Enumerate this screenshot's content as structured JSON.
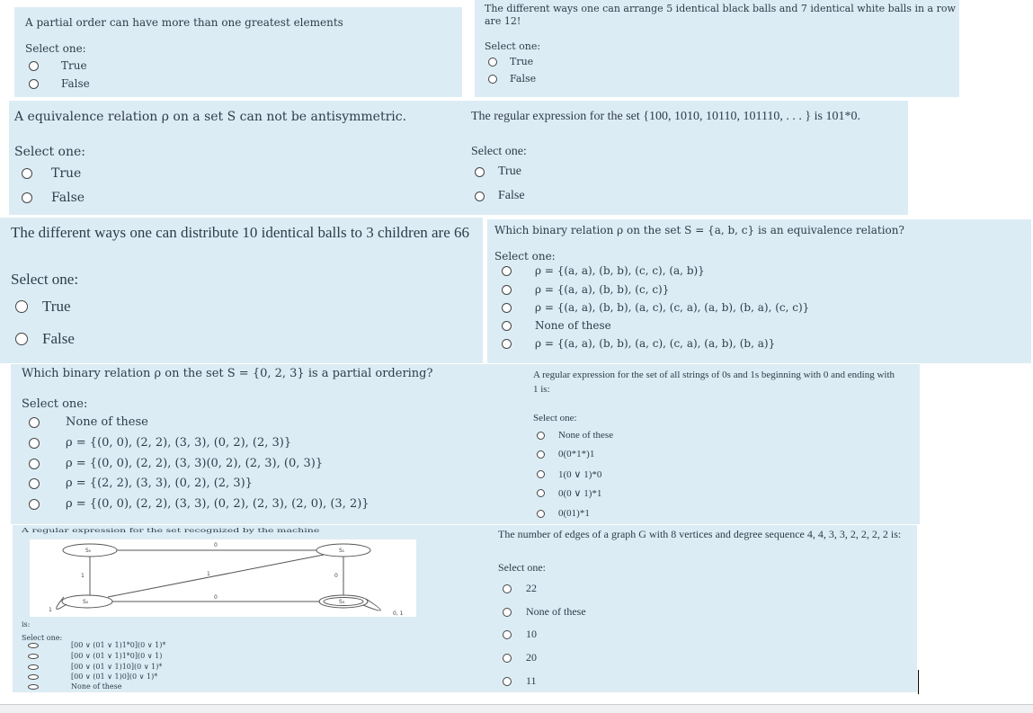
{
  "common": {
    "select_one": "Select one:"
  },
  "q1": {
    "question": "A partial order can have more than one greatest elements",
    "options": [
      "True",
      "False"
    ]
  },
  "q2": {
    "question_line1": "The different ways one can arrange 5 identical black balls and 7 identical white balls in a row",
    "question_line2": "are 12!",
    "options": [
      "True",
      "False"
    ]
  },
  "q3": {
    "question": "A equivalence relation ρ on a set S can not be antisymmetric.",
    "options": [
      "True",
      "False"
    ]
  },
  "q4": {
    "question": "The regular expression for the set {100, 1010, 10110, 101110, . . . } is 101*0.",
    "options": [
      "True",
      "False"
    ]
  },
  "q5": {
    "question": "The different ways one can distribute 10 identical balls to 3 children are 66",
    "options": [
      "True",
      "False"
    ]
  },
  "q6": {
    "question": "Which binary relation ρ on the set S = {a, b, c} is an equivalence relation?",
    "options": [
      "ρ = {(a, a), (b, b), (c, c), (a, b)}",
      "ρ = {(a, a), (b, b), (c, c)}",
      "ρ = {(a, a), (b, b), (a, c), (c, a), (a, b), (b, a), (c, c)}",
      "None of these",
      "ρ = {(a, a), (b, b), (a, c), (c, a), (a, b), (b, a)}"
    ]
  },
  "q7": {
    "question": "Which binary relation ρ on the set S = {0, 2, 3} is a partial ordering?",
    "options": [
      "None of these",
      "ρ = {(0, 0), (2, 2), (3, 3), (0, 2), (2, 3)}",
      "ρ = {(0, 0), (2, 2), (3, 3)(0, 2), (2, 3), (0, 3)}",
      "ρ = {(2, 2), (3, 3), (0, 2), (2, 3)}",
      "ρ = {(0, 0), (2, 2), (3, 3), (0, 2), (2, 3), (2, 0), (3, 2)}"
    ]
  },
  "q8": {
    "question_line1": "A regular expression for the set of all strings of 0s and 1s beginning with 0 and ending with",
    "question_line2": "1 is:",
    "options": [
      "None of these",
      "0(0*1*)1",
      "1(0 ∨ 1)*0",
      "0(0 ∨ 1)*1",
      "0(01)*1"
    ]
  },
  "q9": {
    "question": "A regular expression for the set recognized by the machine",
    "suffix": "is:",
    "options": [
      "[00 ∨ (01 ∨ 1)1*0](0 ∨ 1)*",
      "[00 ∨ (01 ∨ 1)1*0](0 ∨ 1)",
      "[00 ∨ (01 ∨ 1)10](0 ∨ 1)*",
      "[00 ∨ (01 ∨ 1)0](0 ∨ 1)*",
      "None of these"
    ],
    "machine": {
      "states": [
        "S₀",
        "S₁",
        "S₂",
        "S₃"
      ],
      "edge_labels": [
        "0",
        "1",
        "1",
        "0",
        "1",
        "0",
        "0, 1",
        "1"
      ]
    }
  },
  "q10": {
    "question": "The number of edges of a graph G with 8 vertices and degree sequence 4, 4, 3, 3, 2, 2, 2, 2 is:",
    "options": [
      "22",
      "None of these",
      "10",
      "20",
      "11"
    ]
  }
}
